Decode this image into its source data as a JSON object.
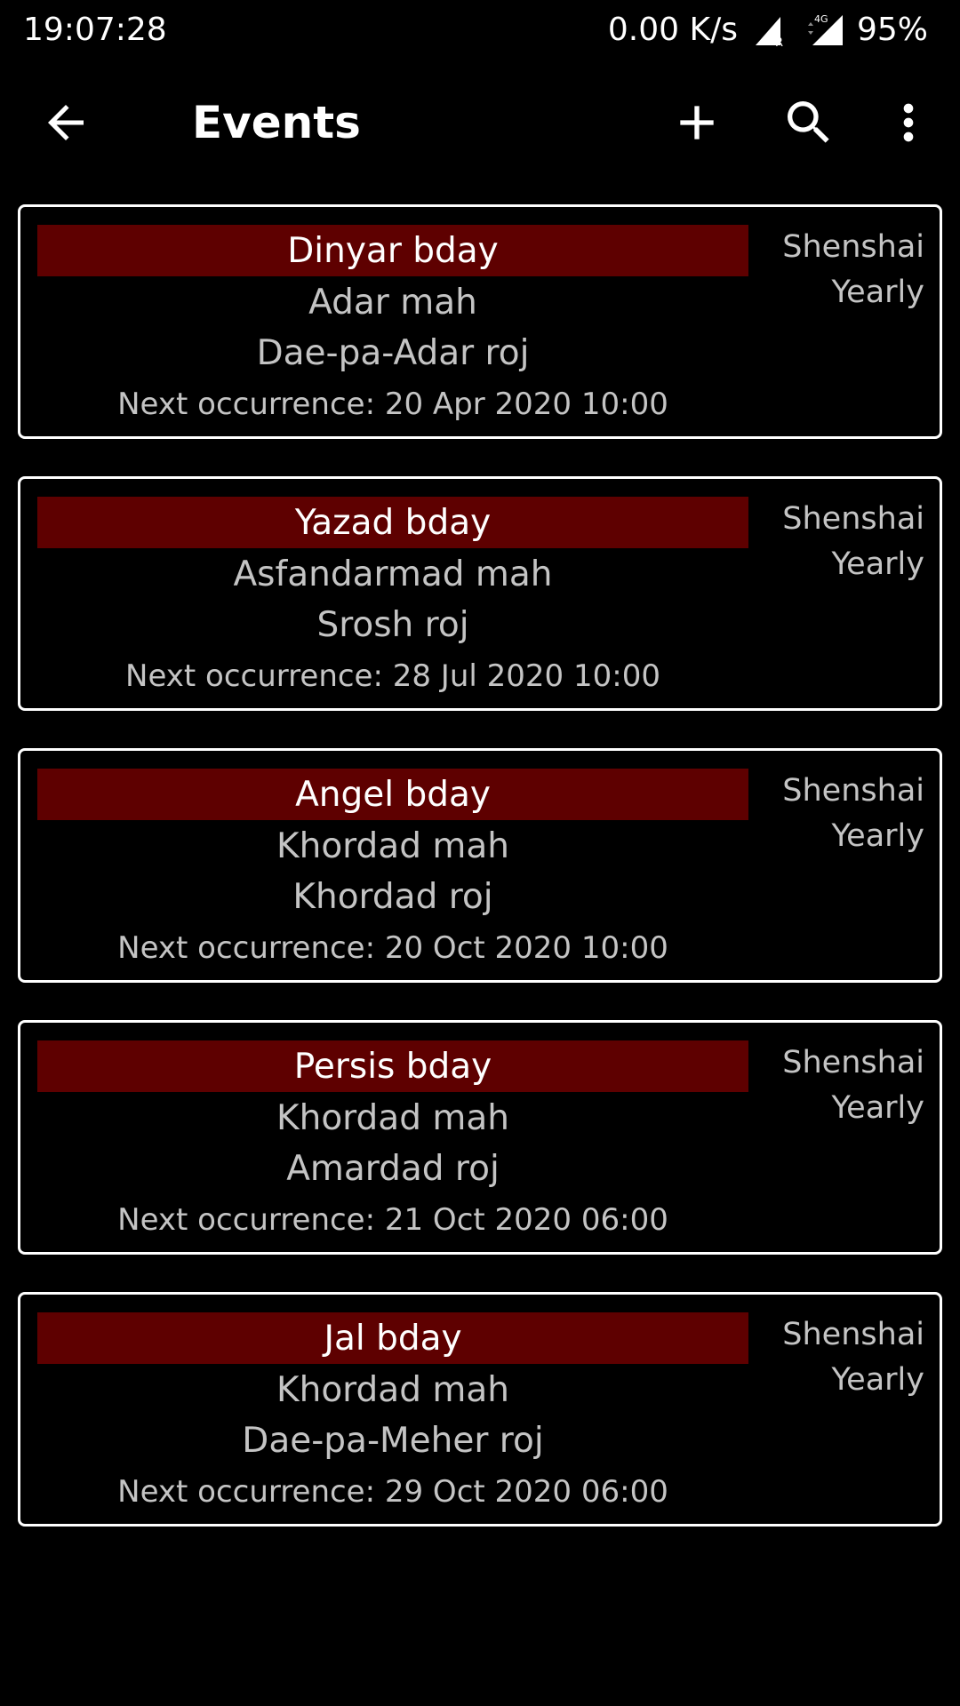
{
  "status_bar": {
    "time": "19:07:28",
    "network_speed": "0.00 K/s",
    "roaming_label": "R",
    "network_type": "4G",
    "battery": "95%"
  },
  "app_bar": {
    "title": "Events",
    "icons": {
      "back": "arrow-back-icon",
      "add": "plus-icon",
      "search": "search-icon",
      "more": "more-vert-icon"
    }
  },
  "events": [
    {
      "name": "Dinyar bday",
      "mah": "Adar mah",
      "roj": "Dae-pa-Adar roj",
      "next": "Next occurrence: 20 Apr 2020 10:00",
      "calendar": "Shenshai",
      "repeat": "Yearly"
    },
    {
      "name": "Yazad bday",
      "mah": "Asfandarmad mah",
      "roj": "Srosh roj",
      "next": "Next occurrence: 28 Jul 2020 10:00",
      "calendar": "Shenshai",
      "repeat": "Yearly"
    },
    {
      "name": "Angel bday",
      "mah": "Khordad mah",
      "roj": "Khordad roj",
      "next": "Next occurrence: 20 Oct 2020 10:00",
      "calendar": "Shenshai",
      "repeat": "Yearly"
    },
    {
      "name": "Persis bday",
      "mah": "Khordad mah",
      "roj": "Amardad roj",
      "next": "Next occurrence: 21 Oct 2020 06:00",
      "calendar": "Shenshai",
      "repeat": "Yearly"
    },
    {
      "name": "Jal bday",
      "mah": "Khordad mah",
      "roj": "Dae-pa-Meher roj",
      "next": "Next occurrence: 29 Oct 2020 06:00",
      "calendar": "Shenshai",
      "repeat": "Yearly"
    }
  ],
  "colors": {
    "background": "#000000",
    "name_bar": "#5e0000",
    "secondary_text": "#c4c4c4",
    "card_border": "#ffffff"
  }
}
